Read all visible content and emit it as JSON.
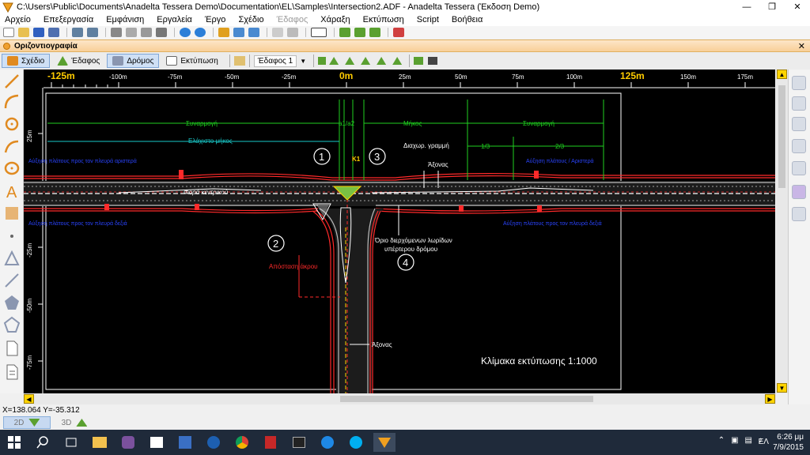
{
  "window": {
    "title": "C:\\Users\\Public\\Documents\\Anadelta Tessera Demo\\Documentation\\EL\\Samples\\Intersection2.ADF - Anadelta Tessera (Έκδοση Demo)",
    "minimize": "—",
    "maximize": "❐",
    "close": "✕"
  },
  "menu": [
    "Αρχείο",
    "Επεξεργασία",
    "Εμφάνιση",
    "Εργαλεία",
    "Έργο",
    "Σχέδιο",
    "Έδαφος",
    "Χάραξη",
    "Εκτύπωση",
    "Script",
    "Βοήθεια"
  ],
  "panel": {
    "label": "Οριζοντιογραφία",
    "close": "✕"
  },
  "tabs": {
    "sxedio": "Σχέδιο",
    "edafos": "Έδαφος",
    "dromos": "Δρόμος",
    "ektyposi": "Εκτύπωση",
    "layer": "Έδαφος 1"
  },
  "ruler": {
    "top": [
      "-125m",
      "-100m",
      "-75m",
      "-50m",
      "-25m",
      "0m",
      "25m",
      "50m",
      "75m",
      "100m",
      "125m",
      "150m",
      "175m"
    ],
    "left": [
      "25m",
      "0m",
      "-25m",
      "-50m",
      "-75m"
    ]
  },
  "drawing": {
    "lbl_synarmogi_left": "Συναρμογή",
    "lbl_a1": "a1/a2",
    "lbl_mikos": "Μήκος",
    "lbl_synarmogi_right": "Συναρμογή",
    "lbl_elaxisto": "Ελάχιστο μήκος",
    "lbl_onethird": "1/3",
    "lbl_twothirds": "2/3",
    "lbl_diaxor": "Διαχωρ. γραμμή",
    "lbl_axonas_top": "Άξονας",
    "lbl_k1": "Κ1",
    "lbl_fora": "Φορά κεντρικού",
    "lbl_orio_line1": "Όριο διερχόμενων λωρίδων",
    "lbl_orio_line2": "υπέρτερου δρόμου",
    "lbl_apostasi": "Απόσταση άκρου",
    "lbl_axonas_bottom": "Άξονας",
    "lbl_klimaka": "Κλίμακα εκτύπωσης 1:1000",
    "lbl_blue_tl": "Αύξηση πλάτους προς τον πλευρά αριστερά",
    "lbl_blue_bl": "Αύξηση πλάτους προς τον πλευρά δεξιά",
    "lbl_blue_tr": "Αύξηση πλάτους / Αριστερά",
    "lbl_blue_br": "Αύξηση πλάτους προς τον πλευρά δεξιά",
    "circle_1": "1",
    "circle_2": "2",
    "circle_3": "3",
    "circle_4": "4"
  },
  "status": {
    "coords": "X=138.064  Y=-35.312"
  },
  "viewtabs": {
    "v2d": "2D",
    "v3d": "3D"
  },
  "taskbar": {
    "lang": "ΕΛ",
    "time": "6:26 μμ",
    "date": "7/9/2015"
  },
  "colors": {
    "canvas": "#000000",
    "green": "#1fd11f",
    "cyan": "#19c7c7",
    "red": "#ff2a2a",
    "blue": "#2a44ff",
    "accent_orange": "#f8cf98"
  }
}
